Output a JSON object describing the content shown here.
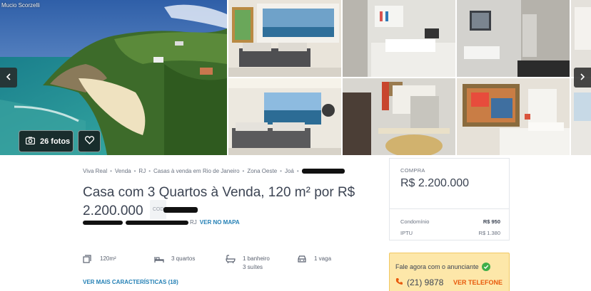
{
  "gallery": {
    "credit": "Mucio Scorzelli",
    "photos_button_label": "26 fotos",
    "icons": {
      "camera": "camera-icon",
      "favorite": "heart-icon",
      "prev": "chevron-left-icon",
      "next": "chevron-right-icon"
    }
  },
  "breadcrumb": [
    "Viva Real",
    "Venda",
    "RJ",
    "Casas à venda em Rio de Janeiro",
    "Zona Oeste",
    "Joá"
  ],
  "listing": {
    "title": "Casa com 3 Quartos à Venda, 120 m² por R$ 2.200.000",
    "code_label": "COD",
    "address_state": "RJ",
    "map_link": "VER NO MAPA"
  },
  "features": [
    {
      "icon": "area-icon",
      "text": "120m²",
      "extra": ""
    },
    {
      "icon": "bed-icon",
      "text": "3 quartos",
      "extra": ""
    },
    {
      "icon": "bath-icon",
      "text": "1 banheiro",
      "extra": "3 suítes"
    },
    {
      "icon": "car-icon",
      "text": "1 vaga",
      "extra": ""
    }
  ],
  "more_features_link": "VER MAIS CARACTERÍSTICAS (18)",
  "price": {
    "label": "COMPRA",
    "value": "R$ 2.200.000",
    "condominio_label": "Condomínio",
    "condominio_value": "R$ 950",
    "iptu_label": "IPTU",
    "iptu_value": "R$ 1.380"
  },
  "contact": {
    "title": "Fale agora com o anunciante",
    "phone_partial": "(21) 9878",
    "reveal_label": "VER TELEFONE"
  },
  "colors": {
    "link": "#2480b5",
    "accent_orange": "#e8590c",
    "contact_bg": "#fde7a9",
    "verified_green": "#3fae49"
  }
}
